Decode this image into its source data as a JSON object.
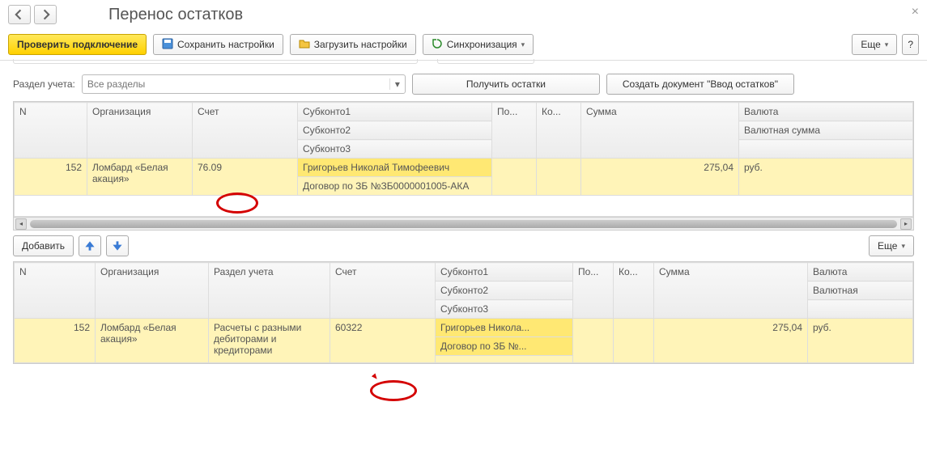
{
  "header": {
    "title": "Перенос остатков"
  },
  "toolbar": {
    "check_connection": "Проверить подключение",
    "save_settings": "Сохранить настройки",
    "load_settings": "Загрузить настройки",
    "sync": "Синхронизация",
    "more": "Еще",
    "help": "?"
  },
  "filter": {
    "section_label": "Раздел учета:",
    "section_placeholder": "Все разделы",
    "get_balances": "Получить остатки",
    "create_doc": "Создать документ \"Ввод остатков\""
  },
  "table1": {
    "headers": {
      "n": "N",
      "org": "Организация",
      "account": "Счет",
      "sub1": "Субконто1",
      "sub2": "Субконто2",
      "sub3": "Субконто3",
      "po": "По...",
      "ko": "Ко...",
      "sum": "Сумма",
      "val": "Валюта",
      "val_sum": "Валютная сумма"
    },
    "row": {
      "n": "152",
      "org": "Ломбард «Белая акация»",
      "account": "76.09",
      "sub1": "Григорьев Николай Тимофеевич",
      "sub2": "Договор по ЗБ №ЗБ0000001005-АКА",
      "sum": "275,04",
      "val": "руб."
    }
  },
  "midbar": {
    "add": "Добавить",
    "more": "Еще"
  },
  "table2": {
    "headers": {
      "n": "N",
      "org": "Организация",
      "section": "Раздел учета",
      "account": "Счет",
      "sub1": "Субконто1",
      "sub2": "Субконто2",
      "sub3": "Субконто3",
      "po": "По...",
      "ko": "Ко...",
      "sum": "Сумма",
      "val": "Валюта",
      "val_sum": "Валютная"
    },
    "row": {
      "n": "152",
      "org": "Ломбард «Белая акация»",
      "section": "Расчеты с разными дебиторами и кредиторами",
      "account": "60322",
      "sub1": "Григорьев Никола...",
      "sub2": "Договор по ЗБ №...",
      "sum": "275,04",
      "val": "руб."
    }
  },
  "annotation": {
    "circle1_value": "76.09",
    "circle2_value": "60322"
  }
}
